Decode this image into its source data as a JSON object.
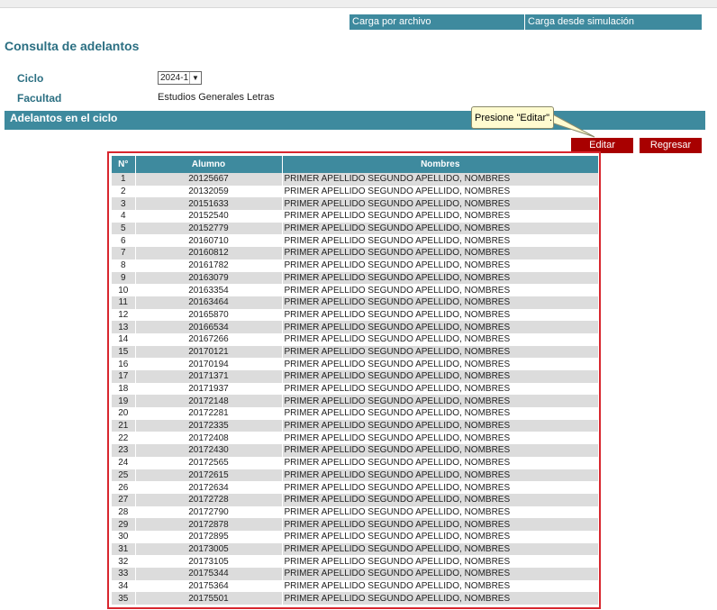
{
  "toplinks": {
    "carga_archivo": "Carga por archivo",
    "carga_simulacion": "Carga desde simulación"
  },
  "page": {
    "title": "Consulta de adelantos"
  },
  "filters": {
    "ciclo_label": "Ciclo",
    "ciclo_value": "2024-1",
    "facultad_label": "Facultad",
    "facultad_value": "Estudios Generales Letras"
  },
  "section": {
    "title": "Adelantos en el ciclo"
  },
  "tooltip": {
    "text": "Presione \"Editar\"."
  },
  "buttons": {
    "editar": "Editar",
    "regresar": "Regresar"
  },
  "table": {
    "headers": [
      "N°",
      "Alumno",
      "Nombres"
    ],
    "rows": [
      [
        "1",
        "20125667",
        "PRIMER APELLIDO SEGUNDO APELLIDO, NOMBRES"
      ],
      [
        "2",
        "20132059",
        "PRIMER APELLIDO SEGUNDO APELLIDO, NOMBRES"
      ],
      [
        "3",
        "20151633",
        "PRIMER APELLIDO SEGUNDO APELLIDO, NOMBRES"
      ],
      [
        "4",
        "20152540",
        "PRIMER APELLIDO SEGUNDO APELLIDO, NOMBRES"
      ],
      [
        "5",
        "20152779",
        "PRIMER APELLIDO SEGUNDO APELLIDO, NOMBRES"
      ],
      [
        "6",
        "20160710",
        "PRIMER APELLIDO SEGUNDO APELLIDO, NOMBRES"
      ],
      [
        "7",
        "20160812",
        "PRIMER APELLIDO SEGUNDO APELLIDO, NOMBRES"
      ],
      [
        "8",
        "20161782",
        "PRIMER APELLIDO SEGUNDO APELLIDO, NOMBRES"
      ],
      [
        "9",
        "20163079",
        "PRIMER APELLIDO SEGUNDO APELLIDO, NOMBRES"
      ],
      [
        "10",
        "20163354",
        "PRIMER APELLIDO SEGUNDO APELLIDO, NOMBRES"
      ],
      [
        "11",
        "20163464",
        "PRIMER APELLIDO SEGUNDO APELLIDO, NOMBRES"
      ],
      [
        "12",
        "20165870",
        "PRIMER APELLIDO SEGUNDO APELLIDO, NOMBRES"
      ],
      [
        "13",
        "20166534",
        "PRIMER APELLIDO SEGUNDO APELLIDO, NOMBRES"
      ],
      [
        "14",
        "20167266",
        "PRIMER APELLIDO SEGUNDO APELLIDO, NOMBRES"
      ],
      [
        "15",
        "20170121",
        "PRIMER APELLIDO SEGUNDO APELLIDO, NOMBRES"
      ],
      [
        "16",
        "20170194",
        "PRIMER APELLIDO SEGUNDO APELLIDO, NOMBRES"
      ],
      [
        "17",
        "20171371",
        "PRIMER APELLIDO SEGUNDO APELLIDO, NOMBRES"
      ],
      [
        "18",
        "20171937",
        "PRIMER APELLIDO SEGUNDO APELLIDO, NOMBRES"
      ],
      [
        "19",
        "20172148",
        "PRIMER APELLIDO SEGUNDO APELLIDO, NOMBRES"
      ],
      [
        "20",
        "20172281",
        "PRIMER APELLIDO SEGUNDO APELLIDO, NOMBRES"
      ],
      [
        "21",
        "20172335",
        "PRIMER APELLIDO SEGUNDO APELLIDO, NOMBRES"
      ],
      [
        "22",
        "20172408",
        "PRIMER APELLIDO SEGUNDO APELLIDO, NOMBRES"
      ],
      [
        "23",
        "20172430",
        "PRIMER APELLIDO SEGUNDO APELLIDO, NOMBRES"
      ],
      [
        "24",
        "20172565",
        "PRIMER APELLIDO SEGUNDO APELLIDO, NOMBRES"
      ],
      [
        "25",
        "20172615",
        "PRIMER APELLIDO SEGUNDO APELLIDO, NOMBRES"
      ],
      [
        "26",
        "20172634",
        "PRIMER APELLIDO SEGUNDO APELLIDO, NOMBRES"
      ],
      [
        "27",
        "20172728",
        "PRIMER APELLIDO SEGUNDO APELLIDO, NOMBRES"
      ],
      [
        "28",
        "20172790",
        "PRIMER APELLIDO SEGUNDO APELLIDO, NOMBRES"
      ],
      [
        "29",
        "20172878",
        "PRIMER APELLIDO SEGUNDO APELLIDO, NOMBRES"
      ],
      [
        "30",
        "20172895",
        "PRIMER APELLIDO SEGUNDO APELLIDO, NOMBRES"
      ],
      [
        "31",
        "20173005",
        "PRIMER APELLIDO SEGUNDO APELLIDO, NOMBRES"
      ],
      [
        "32",
        "20173105",
        "PRIMER APELLIDO SEGUNDO APELLIDO, NOMBRES"
      ],
      [
        "33",
        "20175344",
        "PRIMER APELLIDO SEGUNDO APELLIDO, NOMBRES"
      ],
      [
        "34",
        "20175364",
        "PRIMER APELLIDO SEGUNDO APELLIDO, NOMBRES"
      ],
      [
        "35",
        "20175501",
        "PRIMER APELLIDO SEGUNDO APELLIDO, NOMBRES"
      ]
    ]
  },
  "colors": {
    "accent": "#3e8a9e",
    "title": "#2b6f82",
    "button": "#a80000",
    "highlight_border": "#d8262e",
    "row_alt": "#dcdcdc",
    "tooltip_bg": "#fffbd0"
  }
}
